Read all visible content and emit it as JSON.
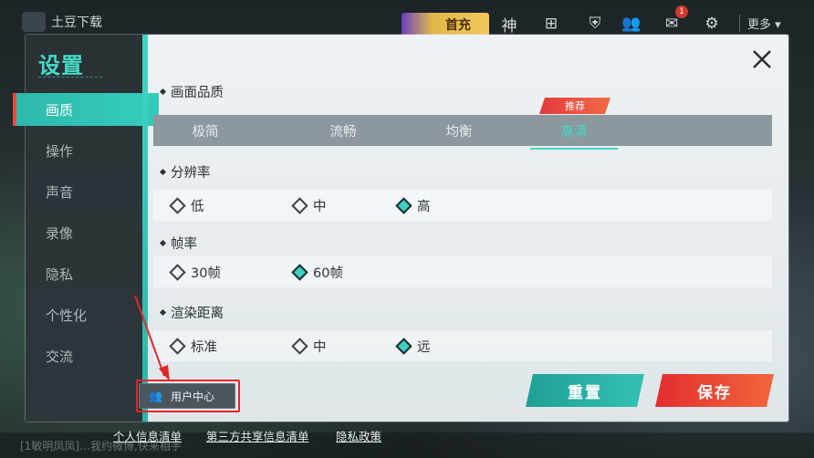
{
  "topbar": {
    "app_name": "土豆下载",
    "first_charge": "首充",
    "icons": [
      "god-icon",
      "grid-icon",
      "friends-icon",
      "mail-icon",
      "gear-icon"
    ],
    "mail_badge": "1",
    "more_label": "更多"
  },
  "bottombar": {
    "chat_text": "[1敏明凤凤]…我约微博,快来相手"
  },
  "settings": {
    "title": "设置",
    "nav": [
      {
        "label": "画质",
        "active": true
      },
      {
        "label": "操作",
        "active": false
      },
      {
        "label": "声音",
        "active": false
      },
      {
        "label": "录像",
        "active": false
      },
      {
        "label": "隐私",
        "active": false
      },
      {
        "label": "个性化",
        "active": false
      },
      {
        "label": "交流",
        "active": false
      }
    ],
    "user_center": "用户中心",
    "sections": {
      "quality": {
        "title": "画面品质",
        "options": [
          "极简",
          "流畅",
          "均衡",
          "高清"
        ],
        "selected": "高清",
        "recommend_tag": "推荐"
      },
      "resolution": {
        "title": "分辨率",
        "options": [
          "低",
          "中",
          "高"
        ],
        "selected": "高"
      },
      "framerate": {
        "title": "帧率",
        "options": [
          "30帧",
          "60帧"
        ],
        "selected": "60帧"
      },
      "render_distance": {
        "title": "渲染距离",
        "options": [
          "标准",
          "中",
          "远"
        ],
        "selected": "远"
      }
    },
    "buttons": {
      "reset": "重置",
      "save": "保存"
    }
  },
  "footer_links": [
    "个人信息清单",
    "第三方共享信息清单",
    "隐私政策"
  ],
  "colors": {
    "accent_teal": "#3fd6c4",
    "highlight_red": "#e0262b",
    "save_red": "#e22d2f"
  }
}
